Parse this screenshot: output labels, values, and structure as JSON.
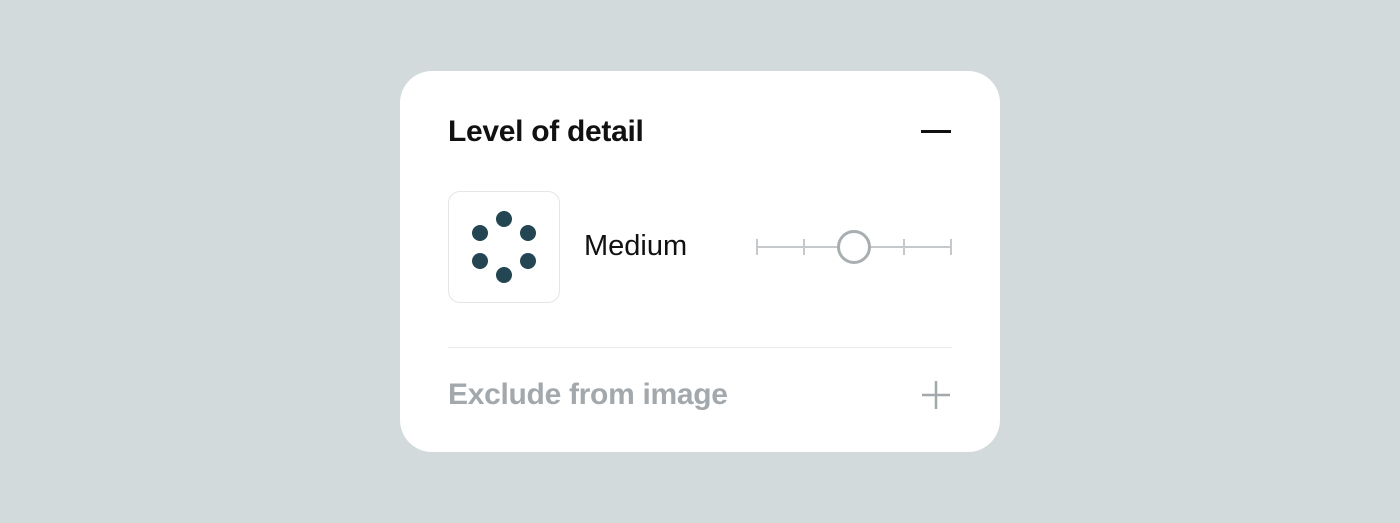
{
  "detail": {
    "title": "Level of detail",
    "value_label": "Medium"
  },
  "exclude": {
    "title": "Exclude from image"
  },
  "colors": {
    "dot": "#234652"
  }
}
